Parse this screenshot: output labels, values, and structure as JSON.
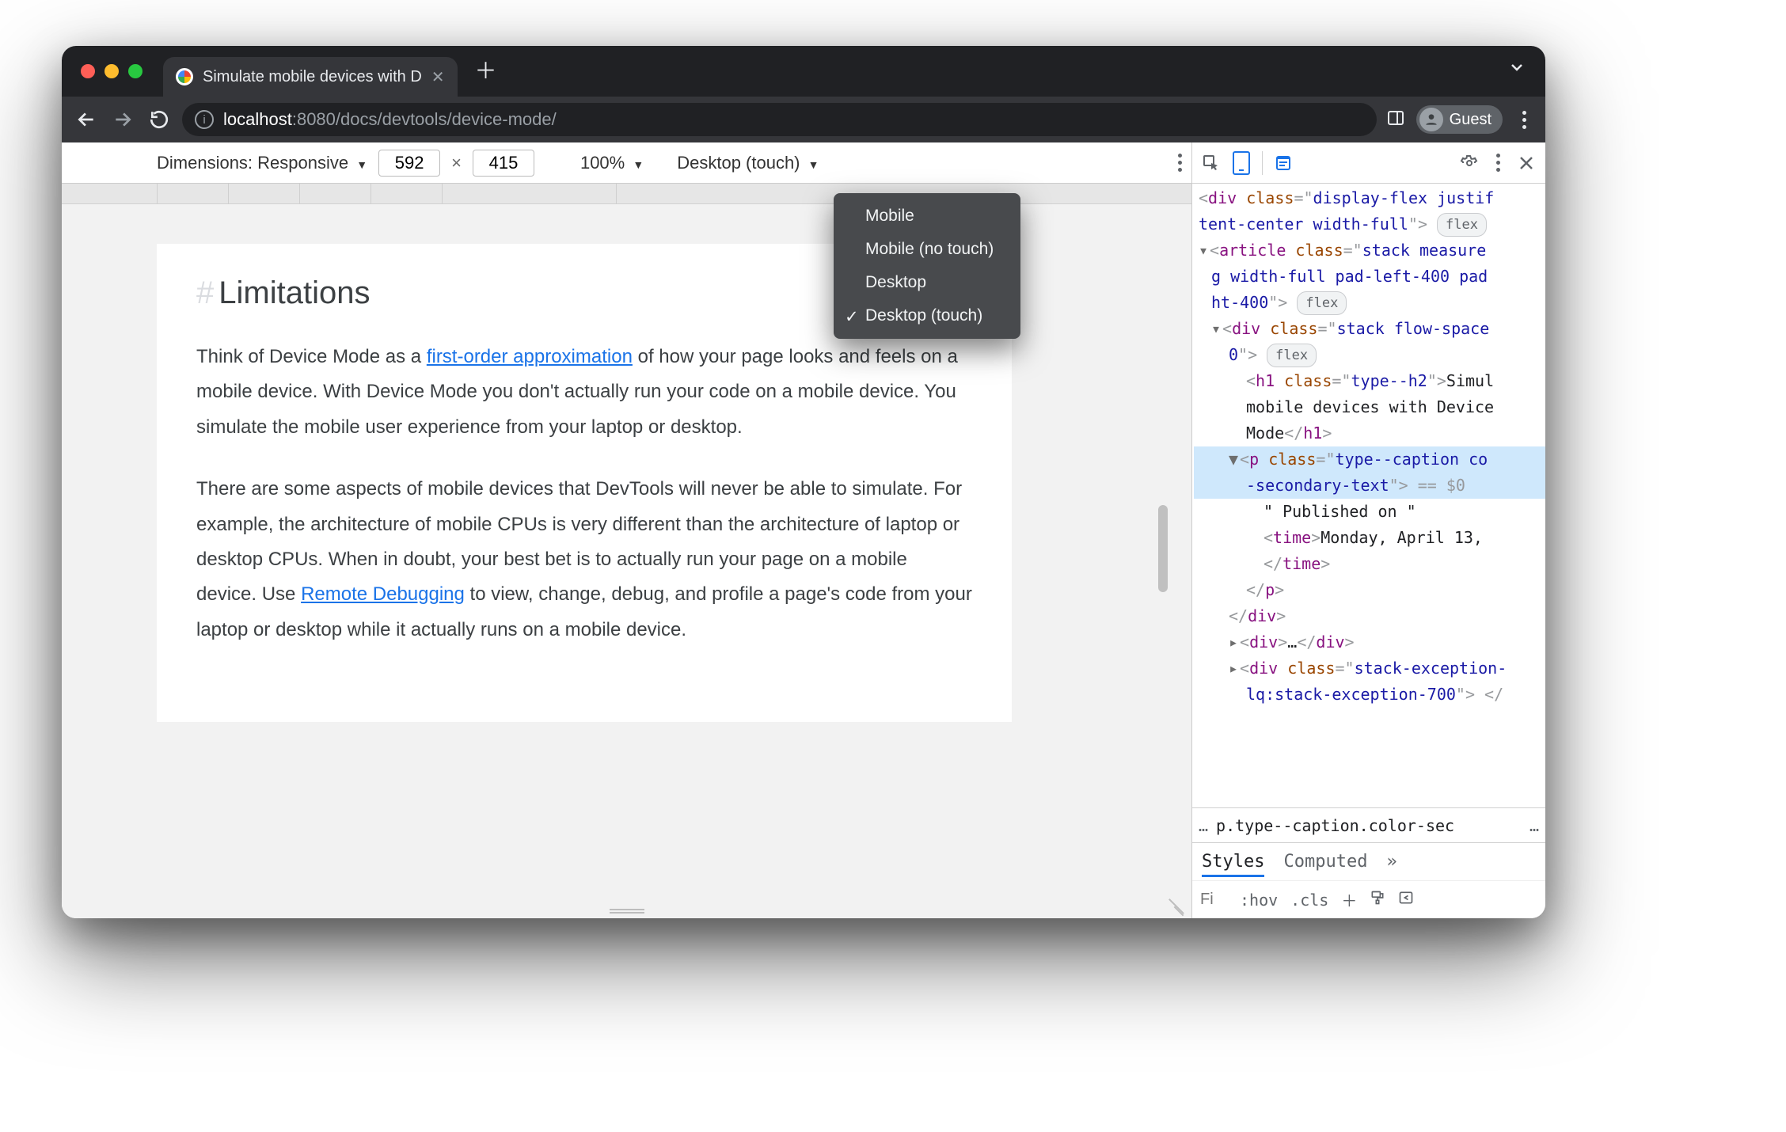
{
  "window": {
    "tab_title": "Simulate mobile devices with D",
    "url_prefix": "localhost",
    "url_port": ":8080",
    "url_path": "/docs/devtools/device-mode/",
    "guest_label": "Guest"
  },
  "device_toolbar": {
    "dimensions_label": "Dimensions: Responsive",
    "width": "592",
    "height": "415",
    "zoom": "100%",
    "device_type": "Desktop (touch)",
    "menu": {
      "items": [
        "Mobile",
        "Mobile (no touch)",
        "Desktop",
        "Desktop (touch)"
      ],
      "selected": "Desktop (touch)"
    }
  },
  "page": {
    "heading": "Limitations",
    "p1_a": "Think of Device Mode as a ",
    "p1_link1": "first-order approximation",
    "p1_b": " of how your page looks and feels on a mobile device. With Device Mode you don't actually run your code on a mobile device. You simulate the mobile user experience from your laptop or desktop.",
    "p2_a": "There are some aspects of mobile devices that DevTools will never be able to simulate. For example, the architecture of mobile CPUs is very different than the architecture of laptop or desktop CPUs. When in doubt, your best bet is to actually run your page on a mobile device. Use ",
    "p2_link": "Remote Debugging",
    "p2_b": " to view, change, debug, and profile a page's code from your laptop or desktop while it actually runs on a mobile device."
  },
  "devtools": {
    "code": {
      "l1a": "div ",
      "l1b": "class",
      "l1c": "display-flex justif",
      "l2": "tent-center width-full",
      "l3a": "article ",
      "l3b": "class",
      "l3c": "stack measure",
      "l4": "g width-full pad-left-400 pad",
      "l5": "ht-400",
      "l6a": "div ",
      "l6b": "class",
      "l6c": "stack flow-space",
      "l7": "0",
      "l8a": "h1 ",
      "l8b": "class",
      "l8c": "type--h2",
      "l8d": "Simul",
      "l9": "mobile devices with Device",
      "l10a": "Mode",
      "l10b": "h1",
      "l11a": "p ",
      "l11b": "class",
      "l11c": "type--caption co",
      "l12": "-secondary-text",
      "l12b": " == $0",
      "l13": "\" Published on \"",
      "l14a": "time",
      "l14b": "Monday, April 13,",
      "l15": "time",
      "l16": "p",
      "l17": "div",
      "l18a": "div",
      "l18b": "…",
      "l18c": "div",
      "l19a": "div ",
      "l19b": "class",
      "l19c": "stack-exception-",
      "l20": "lq:stack-exception-700"
    },
    "crumb": "p.type--caption.color-sec",
    "tabs": {
      "styles": "Styles",
      "computed": "Computed"
    },
    "filter_placeholder": "Fi",
    "hov": ":hov",
    "cls": ".cls"
  }
}
